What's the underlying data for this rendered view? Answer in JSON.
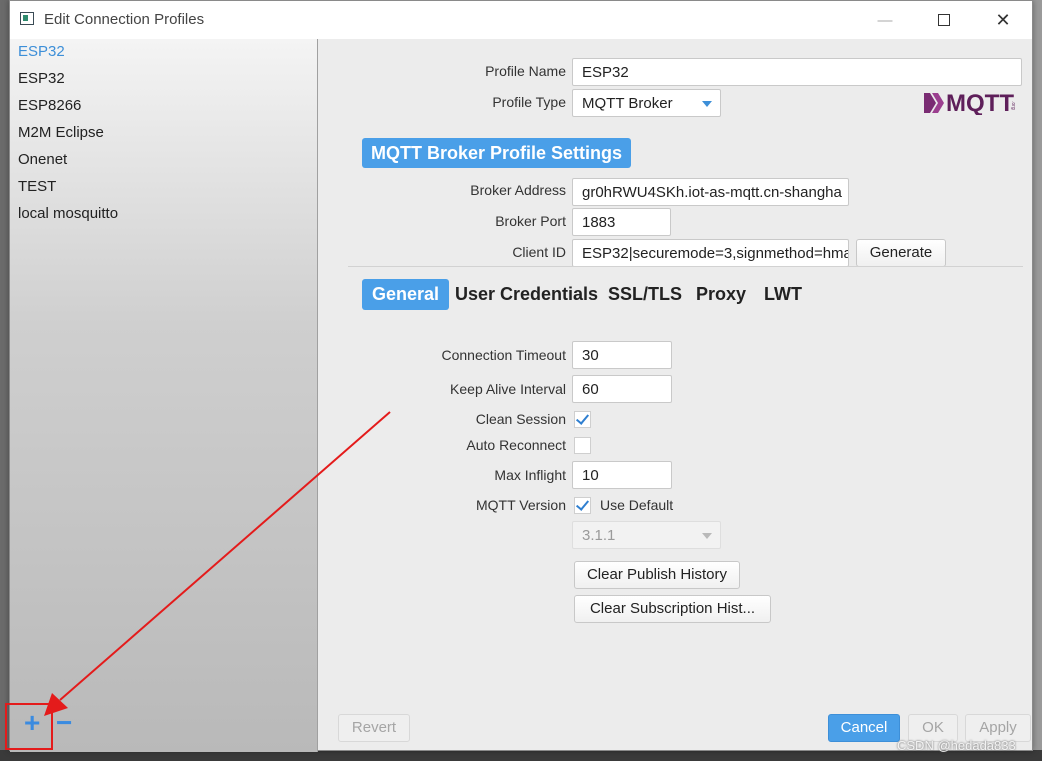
{
  "window": {
    "title": "Edit Connection Profiles"
  },
  "sidebar": {
    "profiles": [
      {
        "label": "ESP32",
        "selected": true
      },
      {
        "label": "ESP32",
        "selected": false
      },
      {
        "label": "ESP8266",
        "selected": false
      },
      {
        "label": "M2M Eclipse",
        "selected": false
      },
      {
        "label": "Onenet",
        "selected": false
      },
      {
        "label": "TEST",
        "selected": false
      },
      {
        "label": "local mosquitto",
        "selected": false
      }
    ],
    "add_label": "+",
    "remove_label": "−"
  },
  "profile": {
    "name_label": "Profile Name",
    "name_value": "ESP32",
    "type_label": "Profile Type",
    "type_value": "MQTT Broker",
    "logo_text": "MQTT",
    "logo_suffix": ".org"
  },
  "broker": {
    "section_title": "MQTT Broker Profile Settings",
    "address_label": "Broker Address",
    "address_value": "gr0hRWU4SKh.iot-as-mqtt.cn-shangha",
    "port_label": "Broker Port",
    "port_value": "1883",
    "client_id_label": "Client ID",
    "client_id_value": "ESP32|securemode=3,signmethod=hma",
    "generate_label": "Generate"
  },
  "tabs": [
    "General",
    "User Credentials",
    "SSL/TLS",
    "Proxy",
    "LWT"
  ],
  "general": {
    "timeout_label": "Connection Timeout",
    "timeout_value": "30",
    "keepalive_label": "Keep Alive Interval",
    "keepalive_value": "60",
    "clean_session_label": "Clean Session",
    "clean_session": true,
    "auto_reconnect_label": "Auto Reconnect",
    "auto_reconnect": false,
    "max_inflight_label": "Max Inflight",
    "max_inflight_value": "10",
    "mqtt_version_label": "MQTT Version",
    "use_default_label": "Use Default",
    "use_default": true,
    "version_value": "3.1.1",
    "clear_publish_label": "Clear Publish History",
    "clear_subscription_label": "Clear Subscription Hist..."
  },
  "footer": {
    "revert_label": "Revert",
    "cancel_label": "Cancel",
    "ok_label": "OK",
    "apply_label": "Apply"
  },
  "watermark": "CSDN @hedada833",
  "colors": {
    "accent": "#4a9fe8",
    "annotation": "#e41b1b"
  }
}
